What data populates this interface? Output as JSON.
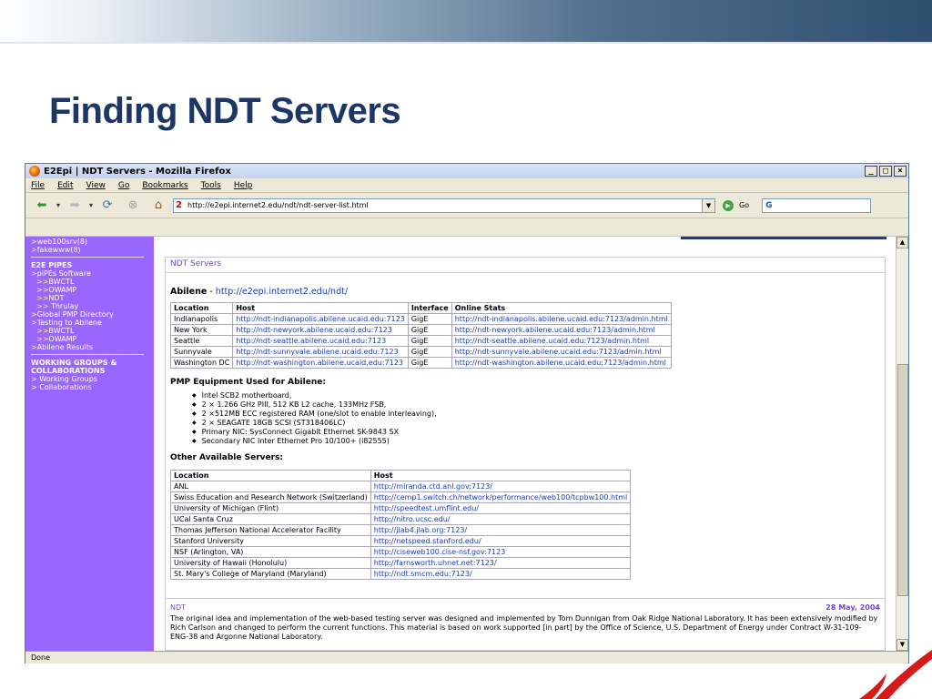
{
  "slide": {
    "title": "Finding NDT Servers"
  },
  "browser": {
    "window_title": "E2Epi | NDT Servers - Mozilla Firefox",
    "menu": [
      "File",
      "Edit",
      "View",
      "Go",
      "Bookmarks",
      "Tools",
      "Help"
    ],
    "url": "http://e2epi.internet2.edu/ndt/ndt-server-list.html",
    "go_label": "Go",
    "search_value": "G",
    "status": "Done",
    "window_buttons": [
      "_",
      "□",
      "×"
    ]
  },
  "sidebar": {
    "top_items": [
      "web100srv(8)",
      "fakewww(8)"
    ],
    "section1_title": "E2E PIPES",
    "section1_items": [
      {
        "prefix": ">",
        "label": "piPEs Software"
      },
      {
        "prefix": ">>",
        "label": "BWCTL"
      },
      {
        "prefix": ">>",
        "label": "OWAMP"
      },
      {
        "prefix": ">>",
        "label": "NDT"
      },
      {
        "prefix": ">>",
        "label": " Thrulay"
      },
      {
        "prefix": ">",
        "label": "Global PMP Directory"
      },
      {
        "prefix": ">",
        "label": "Testing to Abilene"
      },
      {
        "prefix": ">>",
        "label": "BWCTL"
      },
      {
        "prefix": ">>",
        "label": "OWAMP"
      },
      {
        "prefix": ">",
        "label": "Abilene Results"
      }
    ],
    "section2_title_line1": "WORKING GROUPS &",
    "section2_title_line2": "COLLABORATIONS",
    "section2_items": [
      "> Working Groups",
      "> Collaborations"
    ]
  },
  "main": {
    "page_title": "NDT Servers",
    "abilene_label": "Abilene",
    "abilene_sep": " - ",
    "abilene_url": "http://e2epi.internet2.edu/ndt/",
    "abilene_table": {
      "headers": [
        "Location",
        "Host",
        "Interface",
        "Online Stats"
      ],
      "rows": [
        [
          "Indianapolis",
          "http://ndt-indianapolis.abilene.ucaid.edu:7123",
          "GigE",
          "http://ndt-indianapolis.abilene.ucaid.edu:7123/admin.html"
        ],
        [
          "New York",
          "http://ndt-newyork.abilene.ucaid.edu:7123",
          "GigE",
          "http://ndt-newyork.abilene.ucaid.edu:7123/admin.html"
        ],
        [
          "Seattle",
          "http://ndt-seattle.abilene.ucaid.edu:7123",
          "GigE",
          "http://ndt-seattle.abilene.ucaid.edu:7123/admin.html"
        ],
        [
          "Sunnyvale",
          "http://ndt-sunnyvale.abilene.ucaid.edu:7123",
          "GigE",
          "http://ndt-sunnyvale.abilene.ucaid.edu:7123/admin.html"
        ],
        [
          "Washington DC",
          "http://ndt-washington.abilene.ucaid.edu:7123",
          "GigE",
          "http://ndt-washington.abilene.ucaid.edu:7123/admin.html"
        ]
      ]
    },
    "equipment_title": "PMP Equipment Used for Abilene:",
    "equipment": [
      "Intel SCB2 motherboard,",
      "2 × 1.266 GHz PIII, 512 KB L2 cache, 133MHz FSB,",
      "2 ×512MB ECC registered RAM (one/slot to enable interleaving),",
      "2 × SEAGATE 18GB SCSI (ST318406LC)",
      "Primary NIC: SysConnect Gigabit Ethernet SK-9843 SX",
      "Secondary NIC Inter Ethernet Pro 10/100+ (i82555)"
    ],
    "other_title": "Other Available Servers:",
    "other_table": {
      "headers": [
        "Location",
        "Host"
      ],
      "rows": [
        [
          "ANL",
          "http://miranda.ctd.anl.gov:7123/"
        ],
        [
          "Swiss Education and Research Network (Switzerland)",
          "http://cemp1.switch.ch/network/performance/web100/tcpbw100.html"
        ],
        [
          "University of Michigan (Flint)",
          "http://speedtest.umflint.edu/"
        ],
        [
          "UCal Santa Cruz",
          "http://nitro.ucsc.edu/"
        ],
        [
          "Thomas Jefferson National Accelerator Facility",
          "http://jlab4.jlab.org:7123/"
        ],
        [
          "Stanford University",
          "http://netspeed.stanford.edu/"
        ],
        [
          "NSF (Arlington, VA)",
          "http://ciseweb100.cise-nsf.gov:7123"
        ],
        [
          "University of Hawaii (Honolulu)",
          "http://farnsworth.uhnet.net:7123/"
        ],
        [
          "St. Mary's College of Maryland (Maryland)",
          "http://ndt.smcm.edu:7123/"
        ]
      ]
    },
    "footer_label": "NDT",
    "footer_date": "28 May, 2004",
    "footer_text": "The original idea and implementation of the web-based testing server was designed and implemented by Tom Dunnigan from Oak Ridge National Laboratory. It has been extensively modified by Rich Carlson and changed to perform the current functions. This material is based on work supported [in part] by the Office of Science, U.S. Department of Energy under Contract W-31-109-ENG-38 and Argonne National Laboratory."
  },
  "colors": {
    "slide_title": "#1c3766",
    "sidebar_bg": "#9966ff",
    "link": "#1a3bbb",
    "page_title": "#7744dd"
  },
  "icons": {
    "back": "back-arrow-icon",
    "forward": "forward-arrow-icon",
    "reload": "reload-icon",
    "stop": "stop-icon",
    "home": "home-icon",
    "go": "go-icon",
    "search": "google-search-icon"
  }
}
